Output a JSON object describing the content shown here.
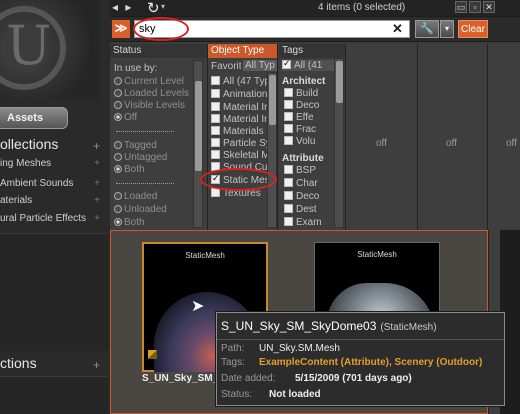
{
  "topbar": {
    "back_forward": "◂ ▸",
    "item_count": "4 items (0 selected)",
    "window_buttons": [
      "▭",
      "▫",
      "✕"
    ]
  },
  "search": {
    "value": "sky",
    "clear_glyph": "✕",
    "collapse_glyph": "≫",
    "clear_label": "Clear"
  },
  "sidebar": {
    "logo_letter": "U",
    "assets_button": "Assets",
    "collections_title": "ollections",
    "collections": [
      "ing Meshes",
      "Ambient Sounds",
      "aterials",
      "ural Particle Effects"
    ],
    "collections2_title": "ctions"
  },
  "filters": {
    "status": {
      "header": "Status",
      "in_use_by": "In use by:",
      "in_use_options": [
        "Current Level",
        "Loaded Levels",
        "Visible Levels",
        "Off"
      ],
      "tagged_options": [
        "Tagged",
        "Untagged",
        "Both"
      ],
      "loaded_options": [
        "Loaded",
        "Unloaded",
        "Both"
      ]
    },
    "object_type": {
      "header": "Object Type",
      "tabs": [
        "Favorit",
        "All Typ"
      ],
      "items": [
        "All (47 Type",
        "Animation S",
        "Material Ins",
        "Material Ins",
        "Materials",
        "Particle Syst",
        "Skeletal Mes",
        "Sound Cue",
        "Static Mesh",
        "Textures"
      ]
    },
    "tags": {
      "header": "Tags",
      "all_label": "All (41",
      "group1": "Architect",
      "group1_items": [
        "Build",
        "Deco",
        "Effe",
        "Frac",
        "Volu"
      ],
      "group2": "Attribute",
      "group2_items": [
        "BSP",
        "Char",
        "Deco",
        "Dest",
        "Exam"
      ]
    },
    "off_labels": [
      "off",
      "off",
      "off"
    ]
  },
  "assets": {
    "tiles": [
      {
        "type_label": "StaticMesh",
        "name": "S_UN_Sky_SM_S"
      },
      {
        "type_label": "StaticMesh",
        "name": ""
      }
    ]
  },
  "tooltip": {
    "title": "S_UN_Sky_SM_SkyDome03",
    "type": "(StaticMesh)",
    "path_key": "Path:",
    "path_val": "UN_Sky.SM.Mesh",
    "tags_key": "Tags:",
    "tags_val": "ExampleContent (Attribute), Scenery (Outdoor)",
    "date_key": "Date added:",
    "date_val": "5/15/2009 (701 days ago)",
    "status_key": "Status:",
    "status_val": "Not loaded"
  },
  "colors": {
    "accent": "#c9582a",
    "highlight_ring": "#e0201c"
  }
}
